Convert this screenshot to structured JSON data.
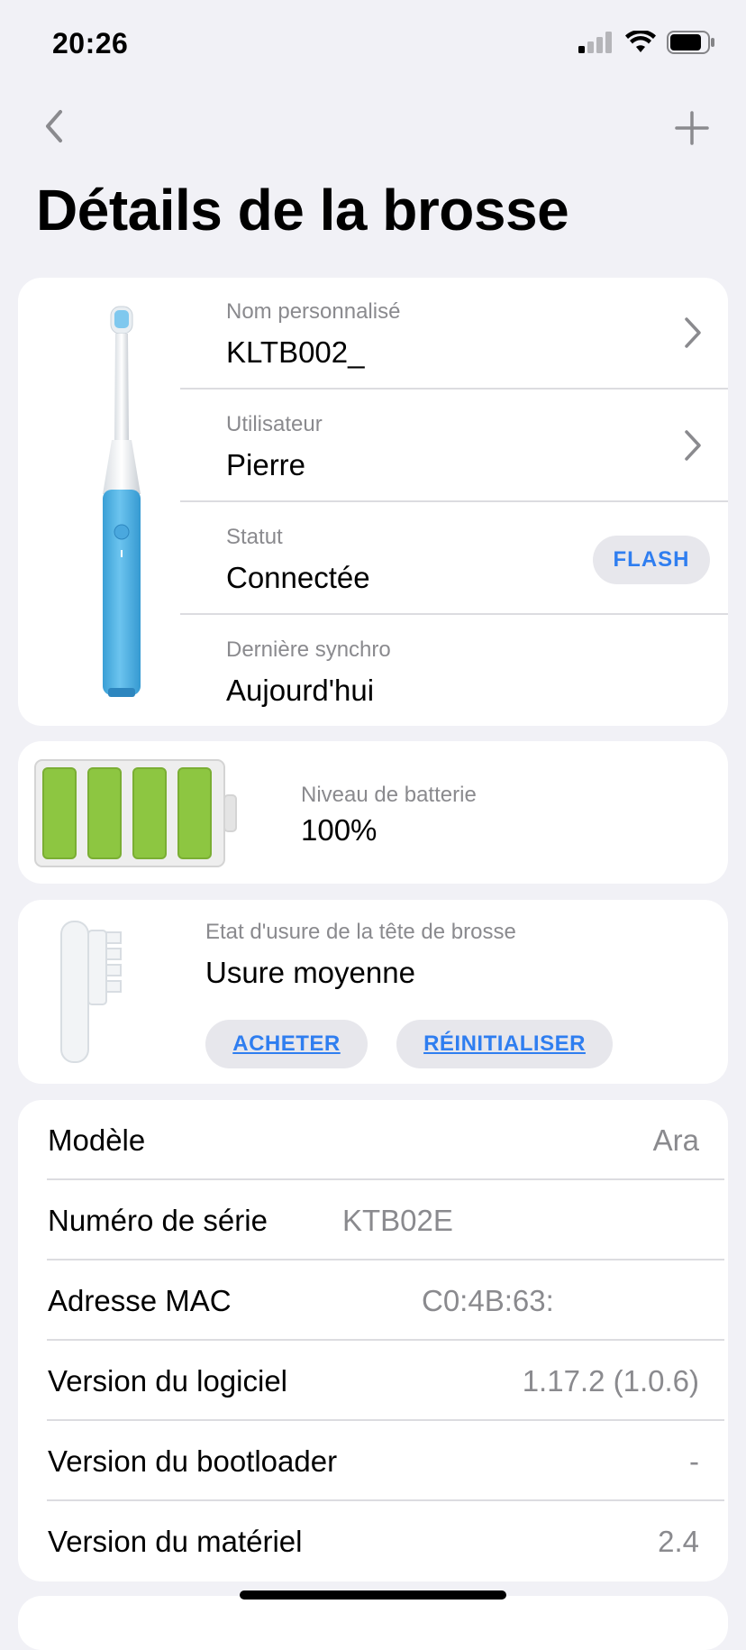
{
  "status_bar": {
    "time": "20:26",
    "signal_icon": "cellular-signal-icon",
    "wifi_icon": "wifi-icon",
    "battery_icon": "battery-icon"
  },
  "nav": {
    "back_icon": "chevron-left-icon",
    "add_icon": "plus-icon"
  },
  "page_title": "Détails de la brosse",
  "device_card": {
    "rows": [
      {
        "label": "Nom personnalisé",
        "value": "KLTB002_"
      },
      {
        "label": "Utilisateur",
        "value": "Pierre"
      },
      {
        "label": "Statut",
        "value": "Connectée"
      },
      {
        "label": "Dernière synchro",
        "value": "Aujourd'hui"
      }
    ],
    "flash_label": "FLASH"
  },
  "battery": {
    "label": "Niveau de batterie",
    "value": "100%",
    "level": 1.0,
    "fill_color": "#8dc641"
  },
  "brush_head": {
    "label": "Etat d'usure de la tête de brosse",
    "value": "Usure moyenne",
    "buy_label": "ACHETER",
    "reset_label": "RÉINITIALISER"
  },
  "specs": [
    {
      "key": "Modèle",
      "value": "Ara"
    },
    {
      "key": "Numéro de série",
      "value": "KTB02E"
    },
    {
      "key": "Adresse MAC",
      "value": "C0:4B:63:"
    },
    {
      "key": "Version du logiciel",
      "value": "1.17.2 (1.0.6)"
    },
    {
      "key": "Version du bootloader",
      "value": "-"
    },
    {
      "key": "Version du matériel",
      "value": "2.4"
    }
  ],
  "colors": {
    "accent": "#2f7ef0",
    "background": "#f1f1f6",
    "brush_body": "#4fb3e6"
  }
}
